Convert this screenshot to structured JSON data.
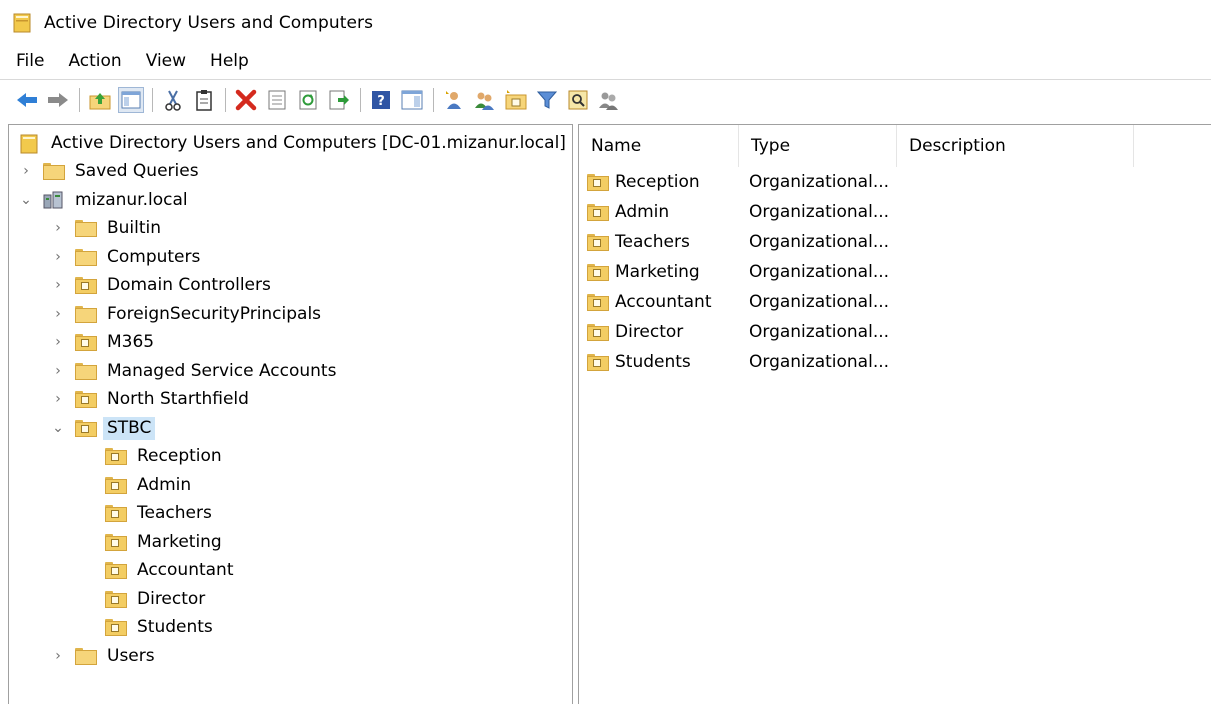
{
  "window": {
    "title": "Active Directory Users and Computers"
  },
  "menu": [
    "File",
    "Action",
    "View",
    "Help"
  ],
  "toolbar": {
    "buttons": [
      "back-arrow-icon",
      "forward-arrow-icon",
      "up-folder-icon",
      "show-hide-console-tree-icon",
      "cut-icon",
      "clipboard-icon",
      "delete-icon",
      "properties-icon",
      "refresh-icon",
      "export-list-icon",
      "help-icon",
      "action-pane-icon",
      "new-user-icon",
      "new-group-icon",
      "new-ou-icon",
      "filter-icon",
      "find-icon",
      "delegate-icon"
    ]
  },
  "tree": {
    "root": "Active Directory Users and Computers [DC-01.mizanur.local]",
    "saved_queries": "Saved Queries",
    "domain": "mizanur.local",
    "children": [
      "Builtin",
      "Computers",
      "Domain Controllers",
      "ForeignSecurityPrincipals",
      "M365",
      "Managed Service Accounts",
      "North Starthfield"
    ],
    "selected": "STBC",
    "stbc_children": [
      "Reception",
      "Admin",
      "Teachers",
      "Marketing",
      "Accountant",
      "Director",
      "Students"
    ],
    "last": "Users"
  },
  "list": {
    "columns": [
      "Name",
      "Type",
      "Description"
    ],
    "rows": [
      {
        "name": "Reception",
        "type": "Organizational..."
      },
      {
        "name": "Admin",
        "type": "Organizational..."
      },
      {
        "name": "Teachers",
        "type": "Organizational..."
      },
      {
        "name": "Marketing",
        "type": "Organizational..."
      },
      {
        "name": "Accountant",
        "type": "Organizational..."
      },
      {
        "name": "Director",
        "type": "Organizational..."
      },
      {
        "name": "Students",
        "type": "Organizational..."
      }
    ]
  },
  "colors": {
    "selection": "#cce4f7",
    "folder": "#f6d57a",
    "border": "#a0a0a0"
  }
}
